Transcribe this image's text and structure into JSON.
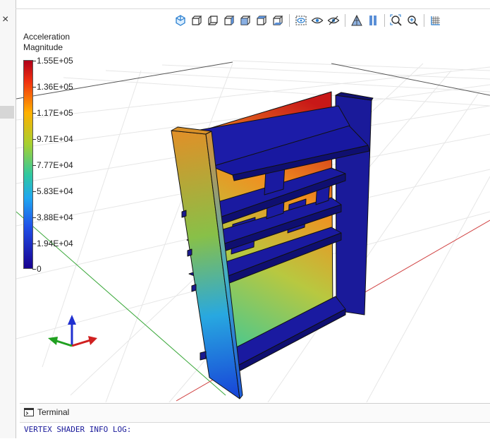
{
  "sidebar": {
    "close_icon": "×"
  },
  "toolbar": {
    "buttons": [
      "view-iso-icon",
      "view-front-icon",
      "view-back-icon",
      "view-left-icon",
      "view-right-icon",
      "view-top-icon",
      "view-bottom-icon",
      "show-hide-icon",
      "eye-icon",
      "eye-hidden-icon",
      "mesh-icon",
      "section-icon",
      "zoom-fit-icon",
      "zoom-in-icon",
      "grid-icon"
    ]
  },
  "legend": {
    "title_line1": "Acceleration",
    "title_line2": "Magnitude",
    "ticks": [
      "1.55E+05",
      "1.36E+05",
      "1.17E+05",
      "9.71E+04",
      "7.77E+04",
      "5.83E+04",
      "3.88E+04",
      "1.94E+04",
      "0"
    ]
  },
  "terminal": {
    "title": "Terminal",
    "log": "VERTEX SHADER INFO LOG:"
  }
}
